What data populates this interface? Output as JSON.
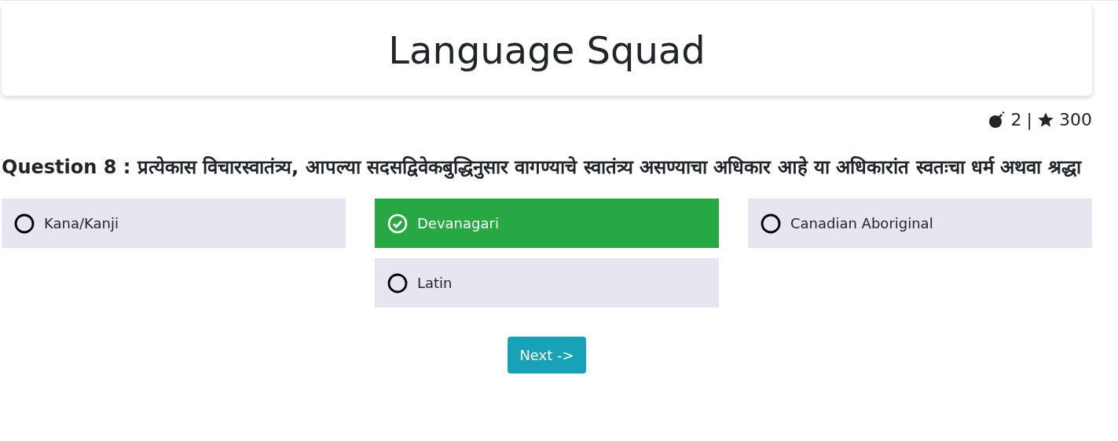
{
  "header": {
    "title": "Language Squad"
  },
  "stats": {
    "bombs": "2",
    "separator": "|",
    "score": "300"
  },
  "question": {
    "text": "Question 8 : प्रत्येकास विचारस्वातंत्र्य, आपल्या सदसद्विवेकबुद्धिनुसार वागण्याचे स्वातंत्र्य असण्याचा अधिकार आहे या अधिकारांत स्वतःचा धर्म अथवा श्रद्धा"
  },
  "options": [
    {
      "label": "Kana/Kanji",
      "selected": false
    },
    {
      "label": "Devanagari",
      "selected": true
    },
    {
      "label": "Canadian Aboriginal",
      "selected": false
    },
    {
      "label": "Latin",
      "selected": false
    }
  ],
  "next_button": {
    "label": "Next ->"
  }
}
